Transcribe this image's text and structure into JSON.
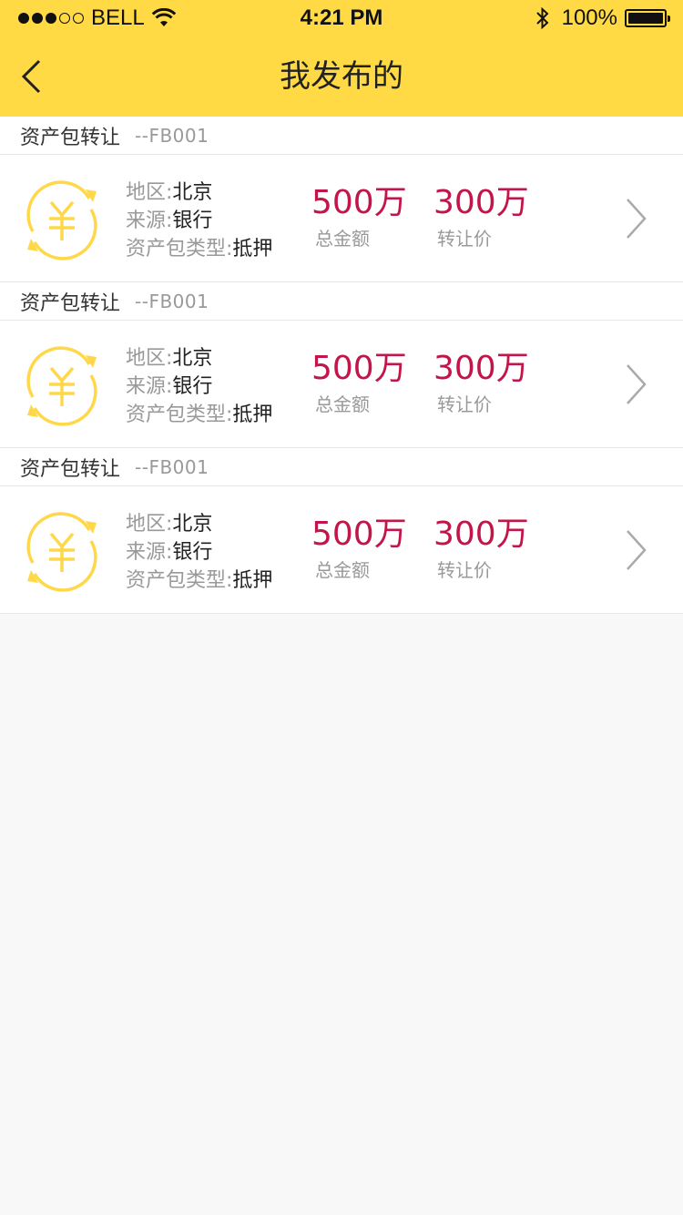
{
  "status_bar": {
    "carrier": "BELL",
    "time": "4:21 PM",
    "battery": "100%"
  },
  "nav": {
    "title": "我发布的"
  },
  "items": [
    {
      "group_title": "资产包转让",
      "group_code": "--FB001",
      "region_label": "地区:",
      "region_value": "北京",
      "source_label": "来源:",
      "source_value": "银行",
      "type_label": "资产包类型:",
      "type_value": "抵押",
      "total_amount": "500万",
      "total_caption": "总金额",
      "transfer_price": "300万",
      "transfer_caption": "转让价"
    },
    {
      "group_title": "资产包转让",
      "group_code": "--FB001",
      "region_label": "地区:",
      "region_value": "北京",
      "source_label": "来源:",
      "source_value": "银行",
      "type_label": "资产包类型:",
      "type_value": "抵押",
      "total_amount": "500万",
      "total_caption": "总金额",
      "transfer_price": "300万",
      "transfer_caption": "转让价"
    },
    {
      "group_title": "资产包转让",
      "group_code": "--FB001",
      "region_label": "地区:",
      "region_value": "北京",
      "source_label": "来源:",
      "source_value": "银行",
      "type_label": "资产包类型:",
      "type_value": "抵押",
      "total_amount": "500万",
      "total_caption": "总金额",
      "transfer_price": "300万",
      "transfer_caption": "转让价"
    }
  ],
  "colors": {
    "brand_yellow": "#ffda44",
    "amount_red": "#c2164a",
    "coin_yellow": "#ffd84a"
  },
  "icons": [
    "back-chevron-icon",
    "yuan-coin-icon",
    "chevron-right-icon",
    "wifi-icon",
    "bluetooth-icon",
    "battery-icon"
  ]
}
